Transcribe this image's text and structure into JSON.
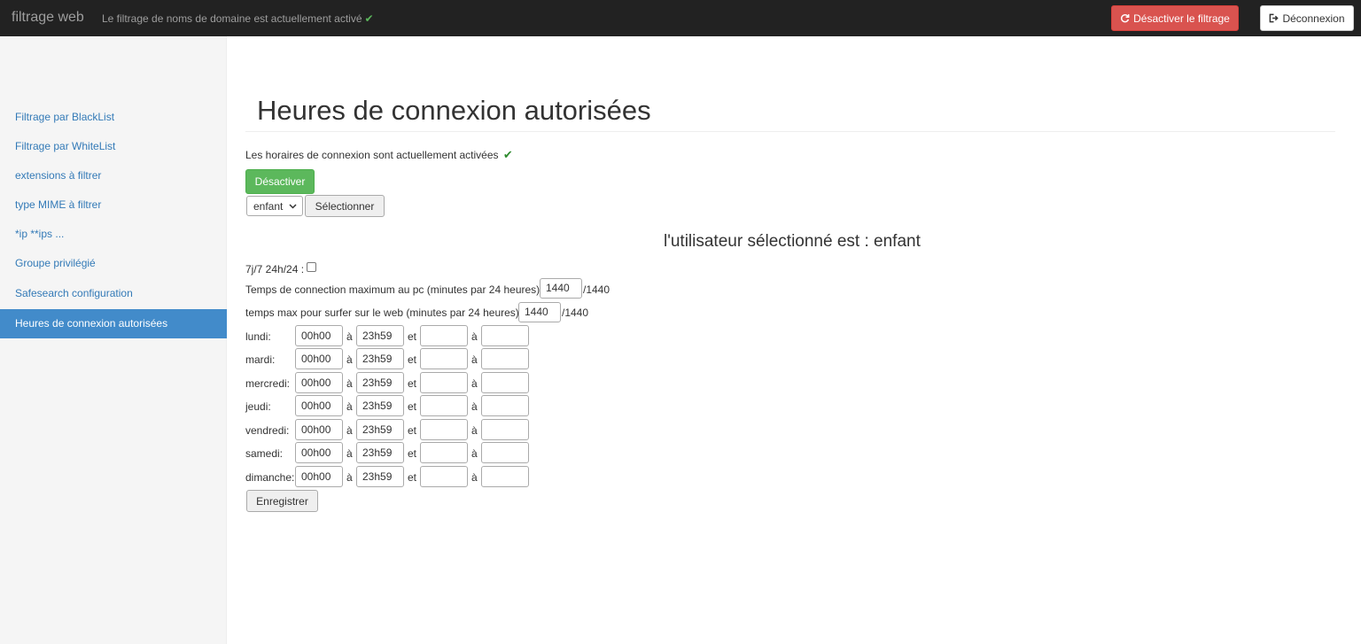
{
  "navbar": {
    "brand": "filtrage web",
    "status_text": "Le filtrage de noms de domaine est actuellement activé",
    "status_icon": "check-icon",
    "disable_filter_label": "Désactiver le filtrage",
    "disable_filter_icon": "refresh-icon",
    "logout_label": "Déconnexion",
    "logout_icon": "sign-out-icon"
  },
  "sidebar": {
    "items": [
      {
        "label": "Filtrage par BlackList",
        "active": false
      },
      {
        "label": "Filtrage par WhiteList",
        "active": false
      },
      {
        "label": "extensions à filtrer",
        "active": false
      },
      {
        "label": "type MIME à filtrer",
        "active": false
      },
      {
        "label": "*ip **ips ...",
        "active": false
      },
      {
        "label": "Groupe privilégié",
        "active": false
      },
      {
        "label": "Safesearch configuration",
        "active": false
      },
      {
        "label": "Heures de connexion autorisées",
        "active": true
      }
    ]
  },
  "main": {
    "title": "Heures de connexion autorisées",
    "status_text": "Les horaires de connexion sont actuellement activées",
    "deactivate_label": "Désactiver",
    "user_select_value": "enfant",
    "select_button_label": "Sélectionner",
    "selected_user_text": "l'utilisateur sélectionné est : enfant",
    "always_label": "7j/7 24h/24 :",
    "always_checked": false,
    "max_pc_label": "Temps de connection maximum au pc (minutes par 24 heures)",
    "max_pc_value": "1440",
    "max_pc_suffix": "/1440",
    "max_web_label": "temps max pour surfer sur le web (minutes par 24 heures)",
    "max_web_value": "1440",
    "max_web_suffix": "/1440",
    "sep_to": "à",
    "sep_and": "et",
    "days": [
      {
        "label": "lundi:",
        "start1": "00h00",
        "end1": "23h59",
        "start2": "",
        "end2": ""
      },
      {
        "label": "mardi:",
        "start1": "00h00",
        "end1": "23h59",
        "start2": "",
        "end2": ""
      },
      {
        "label": "mercredi:",
        "start1": "00h00",
        "end1": "23h59",
        "start2": "",
        "end2": ""
      },
      {
        "label": "jeudi:",
        "start1": "00h00",
        "end1": "23h59",
        "start2": "",
        "end2": ""
      },
      {
        "label": "vendredi:",
        "start1": "00h00",
        "end1": "23h59",
        "start2": "",
        "end2": ""
      },
      {
        "label": "samedi:",
        "start1": "00h00",
        "end1": "23h59",
        "start2": "",
        "end2": ""
      },
      {
        "label": "dimanche:",
        "start1": "00h00",
        "end1": "23h59",
        "start2": "",
        "end2": ""
      }
    ],
    "save_label": "Enregistrer"
  },
  "colors": {
    "navbar_bg": "#222222",
    "danger": "#d9534f",
    "success": "#5cb85c",
    "active_item": "#428bca",
    "link": "#337ab7"
  }
}
